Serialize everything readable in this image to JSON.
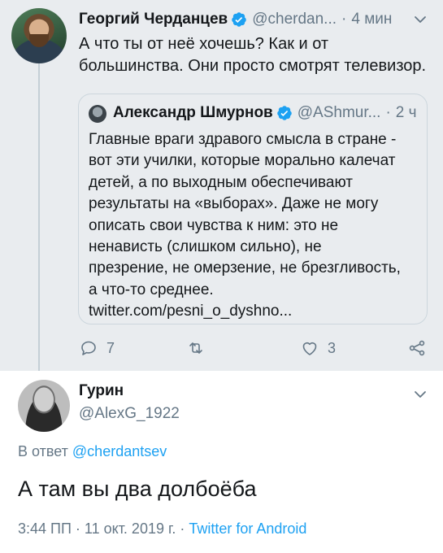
{
  "tweet": {
    "author_name": "Георгий Черданцев",
    "author_handle": "@cherdan...",
    "time": "4 мин",
    "text_lines": [
      "А что ты от неё хочешь? Как и от",
      "большинства. Они просто смотрят телевизор."
    ],
    "quote": {
      "author_name": "Александр Шмурнов",
      "author_handle": "@AShmur...",
      "time": "2 ч",
      "text_lines": [
        "Главные враги здравого смысла в стране -",
        "вот эти училки, которые морально калечат",
        "детей, а по выходным обеспечивают",
        "результаты на «выборах». Даже не могу",
        "описать свои чувства к ним: это не",
        "ненависть (слишком сильно), не",
        "презрение, не омерзение, не брезгливость,",
        "а что-то среднее.",
        "twitter.com/pesni_o_dyshno..."
      ]
    },
    "actions": {
      "replies": "7",
      "likes": "3"
    }
  },
  "reply": {
    "author_name": "Гурин",
    "author_handle": "@AlexG_1922",
    "reply_prefix": "В ответ",
    "reply_to": "@cherdantsev",
    "text": "А там вы два долбоёба",
    "timestamp": "3:44 ПП · 11 окт. 2019 г. ·",
    "source": "Twitter for Android"
  },
  "colors": {
    "accent": "#1da1f2",
    "muted": "#657786",
    "highlight_bg": "#e9ecef"
  },
  "icons": [
    "verified-badge-icon",
    "chevron-down-icon",
    "reply-icon",
    "retweet-icon",
    "like-icon",
    "share-icon"
  ]
}
